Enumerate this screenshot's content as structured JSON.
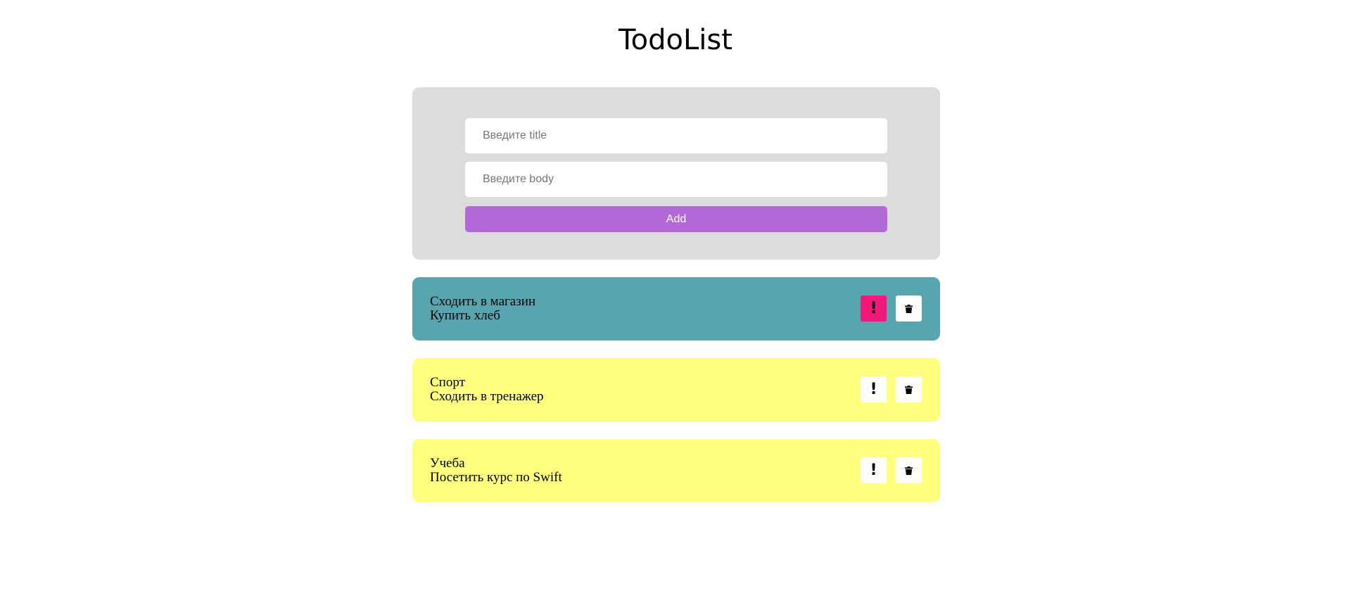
{
  "header": {
    "title": "TodoList"
  },
  "form": {
    "title_placeholder": "Введите title",
    "body_placeholder": "Введите body",
    "add_label": "Add"
  },
  "colors": {
    "form_background": "#dcdcdc",
    "add_button": "#b36ad8",
    "item_important_background": "#58a5b0",
    "item_default_background": "#ffff80",
    "important_button_active": "#f0197a",
    "button_default": "#ffffff"
  },
  "todos": [
    {
      "title": "Сходить в магазин",
      "body": "Купить хлеб",
      "important": true,
      "important_icon": "exclamation-icon",
      "delete_icon": "trash-icon"
    },
    {
      "title": "Спорт",
      "body": "Сходить в тренажер",
      "important": false,
      "important_icon": "exclamation-icon",
      "delete_icon": "trash-icon"
    },
    {
      "title": "Учеба",
      "body": "Посетить курс по Swift",
      "important": false,
      "important_icon": "exclamation-icon",
      "delete_icon": "trash-icon"
    }
  ]
}
